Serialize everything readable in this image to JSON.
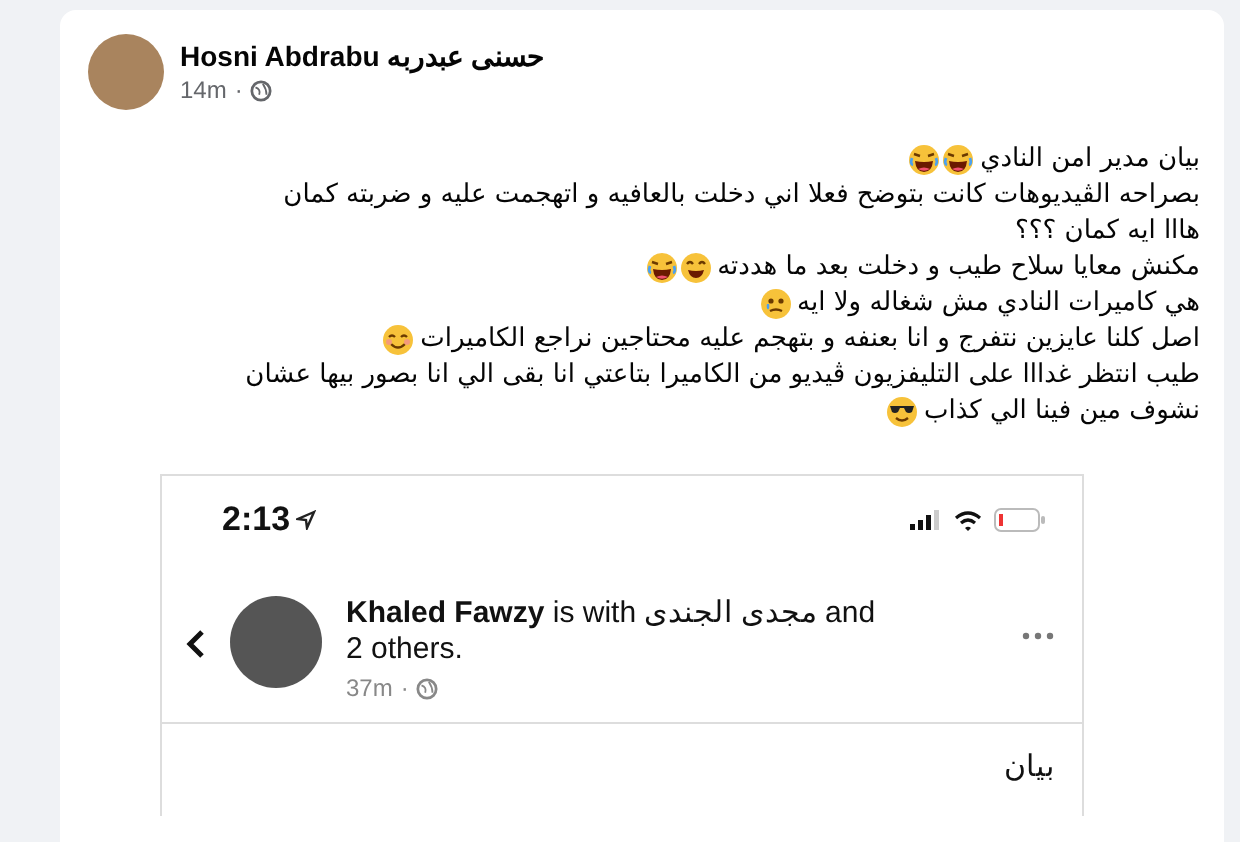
{
  "post": {
    "author": "Hosni Abdrabu حسنى عبدربه",
    "time": "14m",
    "separator": "·",
    "lines": [
      {
        "text": "بيان مدير امن النادي",
        "emojis": [
          {
            "kind": "laughing"
          },
          {
            "kind": "laughing"
          }
        ]
      },
      {
        "text": "بصراحه الڤيديوهات كانت بتوضح فعلا اني دخلت بالعافيه و اتهجمت عليه و ضربته كمان"
      },
      {
        "text": "هااا ايه كمان ؟؟؟"
      },
      {
        "text": "مكنش معايا سلاح طيب و دخلت بعد ما هددته",
        "emojis": [
          {
            "kind": "grinning"
          },
          {
            "kind": "laughing"
          }
        ]
      },
      {
        "text": "هي كاميرات النادي مش شغاله ولا ايه",
        "emojis": [
          {
            "kind": "tearful"
          }
        ]
      },
      {
        "text": "اصل كلنا عايزين نتفرج و انا بعنفه و بتهجم عليه محتاجين نراجع الكاميرات",
        "emojis": [
          {
            "kind": "smiling"
          }
        ]
      },
      {
        "text": "طيب انتظر غدااا على التليفزيون ڤيديو من الكاميرا بتاعتي انا بقى الي انا بصور بيها عشان"
      },
      {
        "text": "نشوف مين فينا الي كذاب",
        "emojis": [
          {
            "kind": "sunglasses"
          }
        ]
      }
    ]
  },
  "screenshot": {
    "clock": "2:13",
    "author": "Khaled Fawzy",
    "with_text": "is with مجدى الجندى and",
    "others": "2 others.",
    "time": "37m",
    "separator": "·",
    "body": "بيان"
  }
}
